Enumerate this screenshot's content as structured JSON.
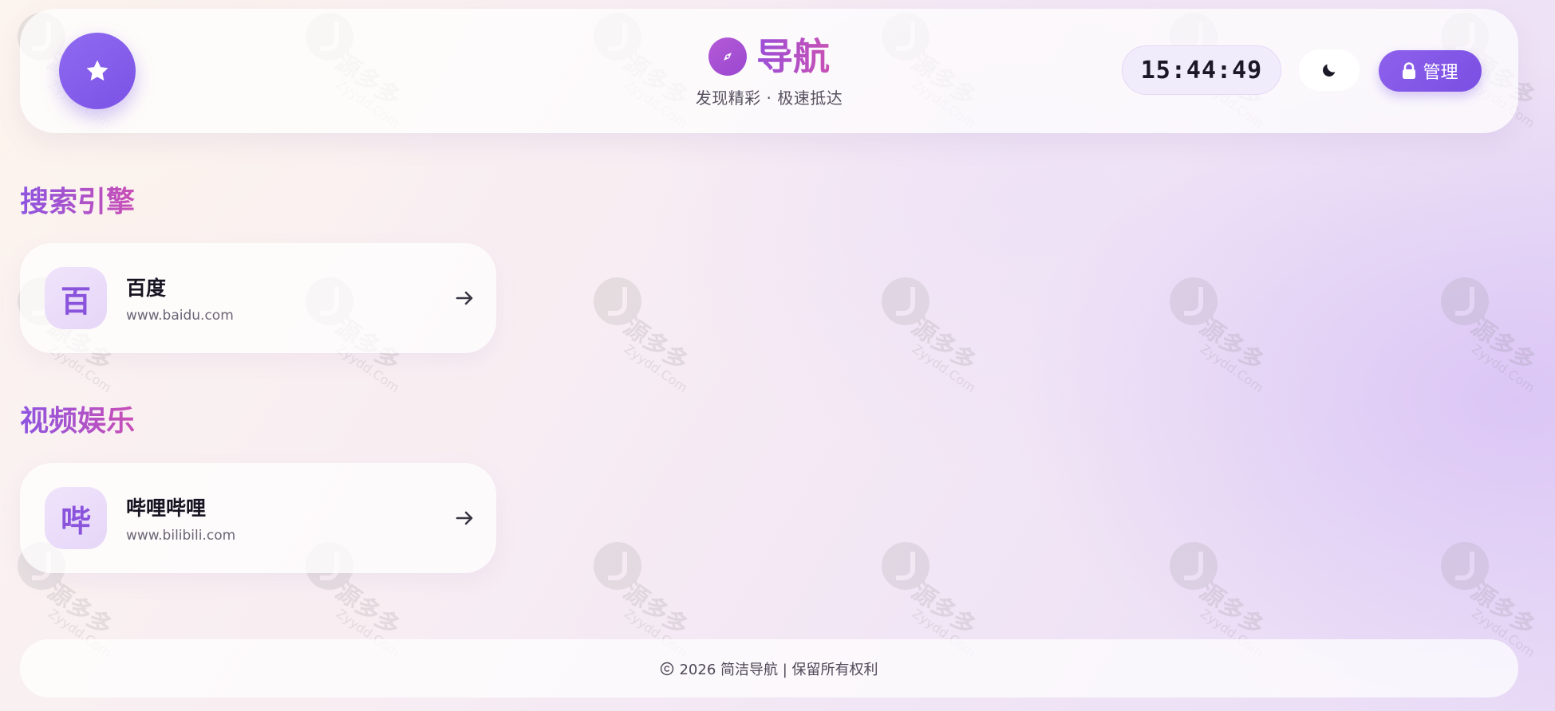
{
  "header": {
    "brand_title": "导航",
    "brand_subtitle": "发现精彩 · 极速抵达",
    "clock": "15:44:49",
    "admin_label": "管理"
  },
  "sections": [
    {
      "title": "搜索引擎",
      "items": [
        {
          "avatar": "百",
          "name": "百度",
          "url": "www.baidu.com"
        }
      ]
    },
    {
      "title": "视频娱乐",
      "items": [
        {
          "avatar": "哔",
          "name": "哔哩哔哩",
          "url": "www.bilibili.com"
        }
      ]
    }
  ],
  "footer": {
    "text": "2026 简洁导航 | 保留所有权利"
  },
  "watermark": {
    "text": "源多多",
    "sub": "Zyydd.Com"
  },
  "colors": {
    "accent": "#7b52e6",
    "brand_gradient_start": "#9b4fd8",
    "brand_gradient_end": "#c850b4"
  },
  "icons": {
    "logo": "star-icon",
    "brand": "compass-icon",
    "theme": "moon-icon",
    "admin": "lock-icon",
    "card_action": "arrow-right-icon",
    "footer": "copyright-icon"
  }
}
